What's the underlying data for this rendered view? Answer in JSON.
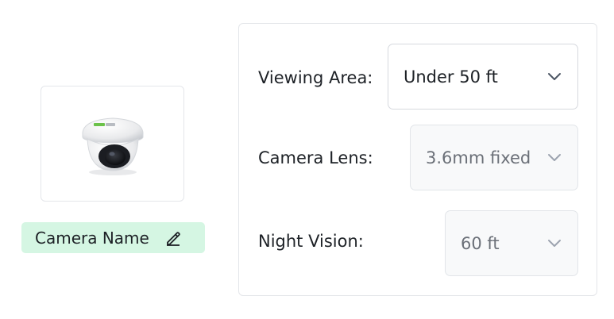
{
  "camera": {
    "image_alt": "dome-security-camera",
    "name_label": "Camera Name",
    "edit_icon": "pencil-icon"
  },
  "options": [
    {
      "label": "Viewing Area:",
      "value": "Under 50 ft",
      "enabled": true
    },
    {
      "label": "Camera Lens:",
      "value": "3.6mm fixed",
      "enabled": false
    },
    {
      "label": "Night Vision:",
      "value": "60 ft",
      "enabled": false
    }
  ],
  "colors": {
    "chip_bg": "#d5f6e3",
    "border": "#e4e6ea",
    "disabled_bg": "#f8f9fa",
    "chevron": "#6b7280"
  }
}
